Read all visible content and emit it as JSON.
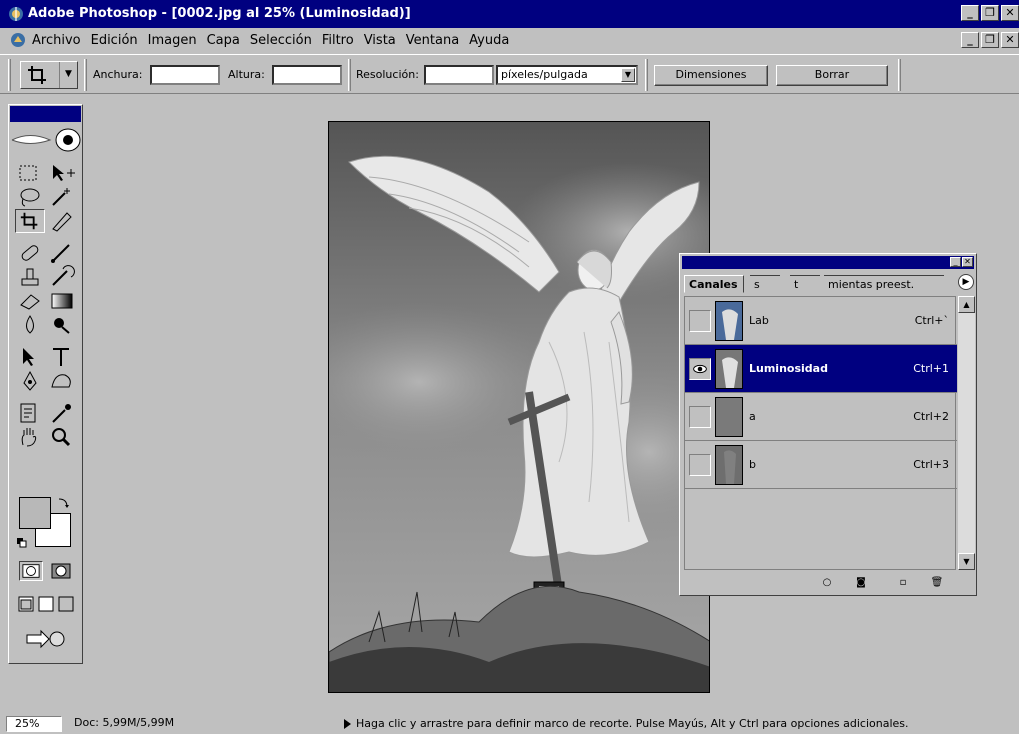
{
  "window": {
    "title": "Adobe Photoshop - [0002.jpg al 25% (Luminosidad)]",
    "buttons": {
      "minimize": "_",
      "restore": "❐",
      "close": "✕"
    }
  },
  "menubar": {
    "items": [
      "Archivo",
      "Edición",
      "Imagen",
      "Capa",
      "Selección",
      "Filtro",
      "Vista",
      "Ventana",
      "Ayuda"
    ]
  },
  "options": {
    "width_label": "Anchura:",
    "width_value": "",
    "height_label": "Altura:",
    "height_value": "",
    "resolution_label": "Resolución:",
    "resolution_value": "",
    "resolution_unit": "píxeles/pulgada",
    "front_image_button": "Dimensiones",
    "clear_button": "Borrar"
  },
  "channels_panel": {
    "tabs": [
      "Canales",
      "s",
      "t",
      "mientas preest."
    ],
    "channels": [
      {
        "name": "Lab",
        "shortcut": "Ctrl+`",
        "visible": false,
        "selected": false
      },
      {
        "name": "Luminosidad",
        "shortcut": "Ctrl+1",
        "visible": true,
        "selected": true
      },
      {
        "name": "a",
        "shortcut": "Ctrl+2",
        "visible": false,
        "selected": false
      },
      {
        "name": "b",
        "shortcut": "Ctrl+3",
        "visible": false,
        "selected": false
      }
    ]
  },
  "status": {
    "zoom": "25%",
    "doc": "Doc: 5,99M/5,99M",
    "message": "Haga clic y arrastre para definir marco de recorte. Pulse Mayús, Alt y Ctrl para opciones adicionales."
  },
  "colors": {
    "title_bar": "#000080",
    "chrome": "#c0c0c0",
    "selection": "#000080"
  }
}
